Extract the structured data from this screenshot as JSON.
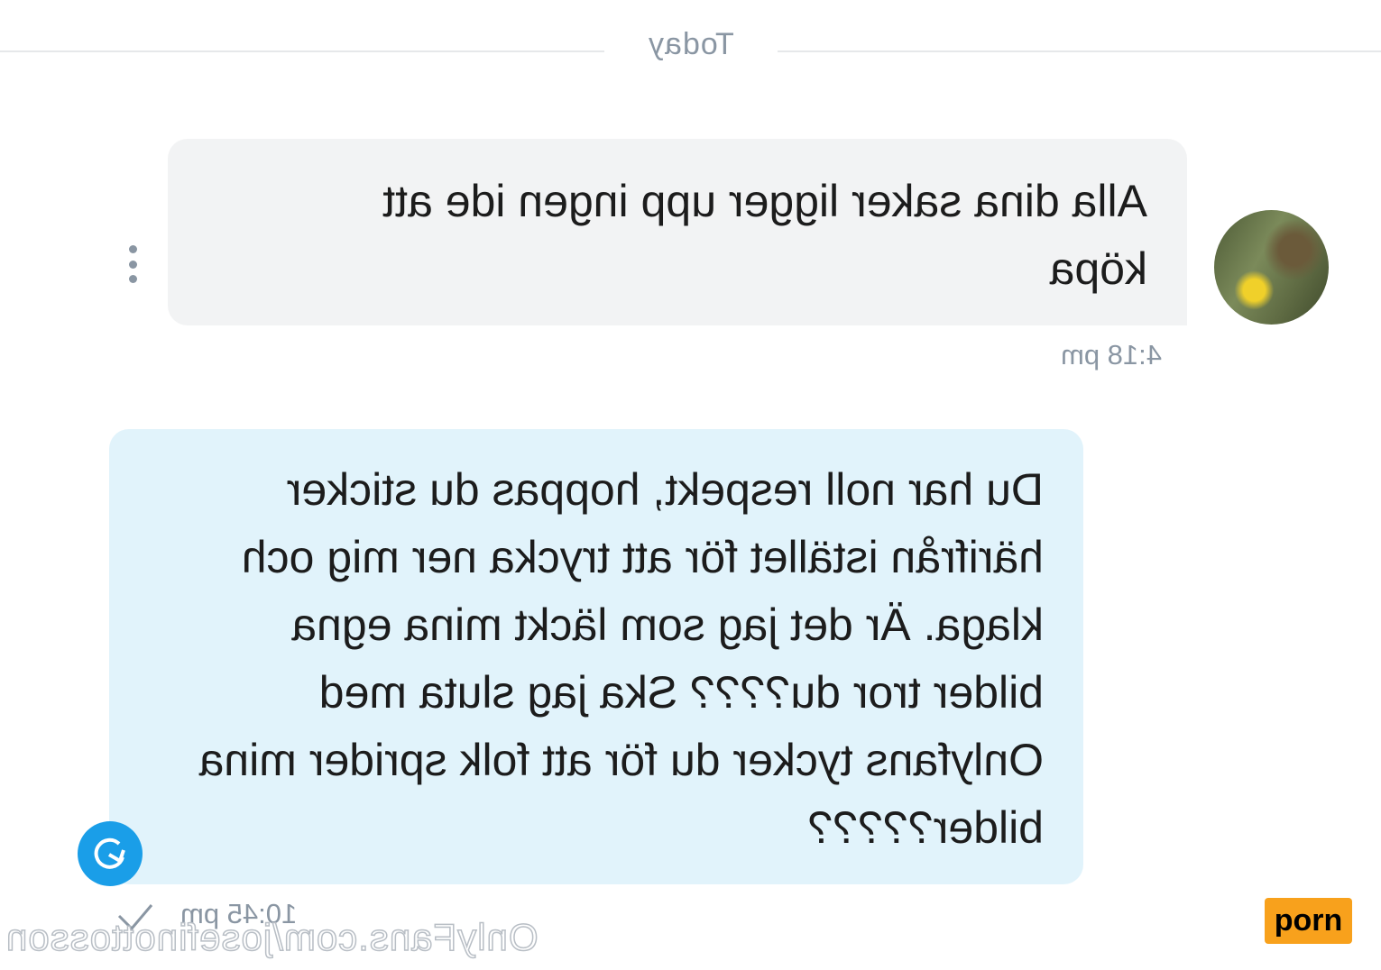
{
  "day_separator": "Today",
  "messages": [
    {
      "direction": "incoming",
      "text": "Alla dina saker ligger upp ingen ide att köpa",
      "time": "4:18 pm"
    },
    {
      "direction": "outgoing",
      "text": "Du har noll respekt, hoppas du sticker härifrån istället för att trycka ner mig och klaga. Är det jag som läckt mina egna bilder tror du???? Ska jag sluta med Onlyfans tycker du för att folk sprider mina bilder?????",
      "time": "10:45 pm"
    }
  ],
  "watermark": "OnlyFans.com/josefinottosson",
  "badge": "porn",
  "icons": {
    "message_menu": "more-vertical-icon",
    "scroll_button": "refresh-arrow-icon",
    "read_receipt": "checkmark-icon"
  },
  "colors": {
    "incoming_bubble": "#f2f3f4",
    "outgoing_bubble": "#e1f3fb",
    "accent": "#1a9ee8",
    "muted_text": "#8a96a3",
    "badge": "#f8a11c"
  }
}
